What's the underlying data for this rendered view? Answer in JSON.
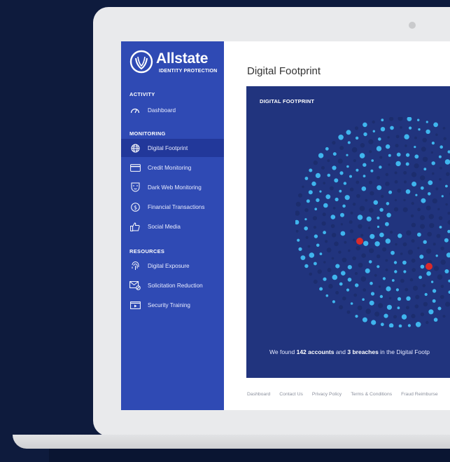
{
  "brand": {
    "name": "Allstate",
    "tm": "™",
    "sub": "IDENTITY PROTECTION"
  },
  "page_title": "Digital Footprint",
  "sidebar": {
    "sections": [
      {
        "title": "ACTIVITY",
        "items": [
          {
            "label": "Dashboard",
            "icon": "speedometer-icon"
          }
        ]
      },
      {
        "title": "MONITORING",
        "items": [
          {
            "label": "Digital Footprint",
            "icon": "globe-icon",
            "active": true
          },
          {
            "label": "Credit Monitoring",
            "icon": "credit-card-icon"
          },
          {
            "label": "Dark Web Monitoring",
            "icon": "mask-icon"
          },
          {
            "label": "Financial Transactions",
            "icon": "dollar-icon"
          },
          {
            "label": "Social Media",
            "icon": "thumbs-up-icon"
          }
        ]
      },
      {
        "title": "RESOURCES",
        "items": [
          {
            "label": "Digital Exposure",
            "icon": "fingerprint-icon"
          },
          {
            "label": "Solicitation Reduction",
            "icon": "mail-blocked-icon"
          },
          {
            "label": "Security Training",
            "icon": "video-icon"
          }
        ]
      }
    ]
  },
  "card": {
    "label": "DIGITAL FOOTPRINT",
    "summary_prefix": "We found ",
    "accounts": "142 accounts",
    "summary_and": " and ",
    "breaches": "3 breaches",
    "summary_suffix": " in the Digital Footp",
    "colors": {
      "background": "#21347e",
      "dot_bright": "#3fb5ee",
      "dot_dim": "#1c2d6e",
      "breach": "#d92a2a"
    }
  },
  "footer": [
    "Dashboard",
    "Contact Us",
    "Privacy Policy",
    "Terms & Conditions",
    "Fraud Reimburse"
  ]
}
